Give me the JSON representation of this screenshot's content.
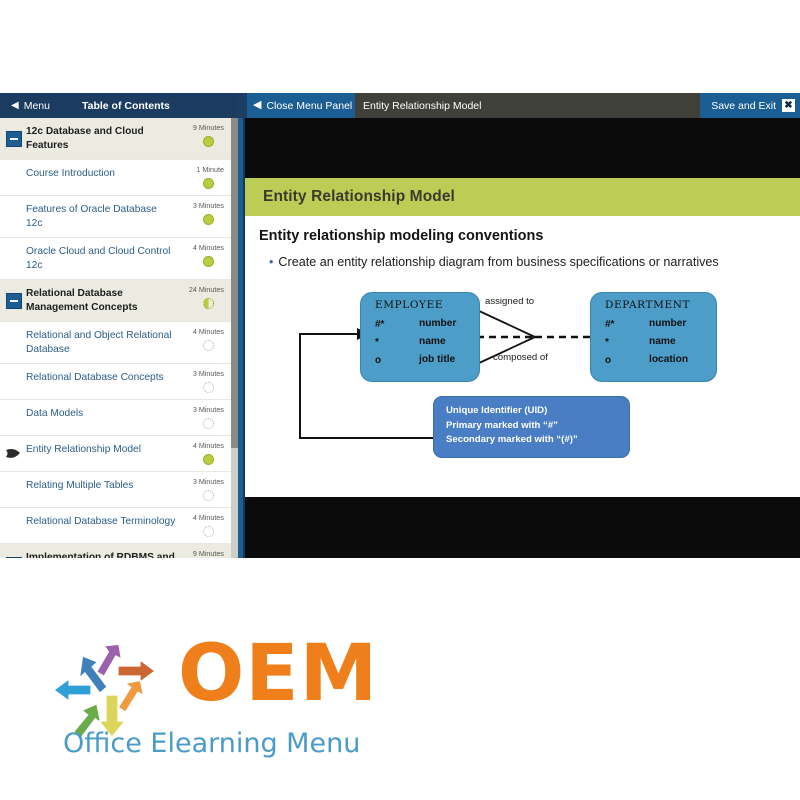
{
  "header": {
    "menu_label": "Menu",
    "menu_chevron": "chevron-left-icon",
    "toc_label": "Table of Contents",
    "close_panel_label": "Close Menu Panel",
    "close_panel_chevron": "chevron-left-icon",
    "lesson_title": "Entity Relationship Model",
    "save_exit_label": "Save and Exit",
    "close_x_label": "✖",
    "colors": {
      "navy": "#1b3c60",
      "blue": "#1b5e94",
      "title_bar": "#40403a"
    }
  },
  "sidebar": {
    "scroll_position": "top",
    "items": [
      {
        "label": "12c Database and Cloud Features",
        "minutes": "9 Minutes",
        "type": "group",
        "status": "done",
        "expander": "collapse-icon",
        "current": false
      },
      {
        "label": "Course Introduction",
        "minutes": "1 Minute",
        "type": "topic",
        "status": "done",
        "current": false
      },
      {
        "label": "Features of Oracle Database 12c",
        "minutes": "3 Minutes",
        "type": "topic",
        "status": "done",
        "current": false
      },
      {
        "label": "Oracle Cloud and Cloud Control 12c",
        "minutes": "4 Minutes",
        "type": "topic",
        "status": "done",
        "current": false
      },
      {
        "label": "Relational Database Management Concepts",
        "minutes": "24 Minutes",
        "type": "group",
        "status": "partial",
        "expander": "collapse-icon",
        "current": false
      },
      {
        "label": "Relational and Object Relational Database",
        "minutes": "4 Minutes",
        "type": "topic",
        "status": "none",
        "current": false
      },
      {
        "label": "Relational Database Concepts",
        "minutes": "3 Minutes",
        "type": "topic",
        "status": "none",
        "current": false
      },
      {
        "label": "Data Models",
        "minutes": "3 Minutes",
        "type": "topic",
        "status": "none",
        "current": false
      },
      {
        "label": "Entity Relationship Model",
        "minutes": "4 Minutes",
        "type": "topic",
        "status": "done",
        "current": true
      },
      {
        "label": "Relating Multiple Tables",
        "minutes": "3 Minutes",
        "type": "topic",
        "status": "none",
        "current": false
      },
      {
        "label": "Relational Database Terminology",
        "minutes": "4 Minutes",
        "type": "topic",
        "status": "none",
        "current": false
      },
      {
        "label": "Implementation of RDBMS and ORDMS",
        "minutes": "9 Minutes",
        "type": "group",
        "status": "none",
        "expander": "collapse-icon",
        "current": false
      }
    ]
  },
  "slide": {
    "title": "Entity Relationship Model",
    "subtitle": "Entity relationship modeling conventions",
    "bullet": "Create an entity relationship diagram from business specifications or narratives",
    "title_bar_color": "#bccc54",
    "diagram": {
      "entities": [
        {
          "name": "EMPLOYEE",
          "attributes": [
            {
              "mark": "#*",
              "name": "number"
            },
            {
              "mark": "*",
              "name": "name"
            },
            {
              "mark": "o",
              "name": "job title"
            }
          ]
        },
        {
          "name": "DEPARTMENT",
          "attributes": [
            {
              "mark": "#*",
              "name": "number"
            },
            {
              "mark": "*",
              "name": "name"
            },
            {
              "mark": "o",
              "name": "location"
            }
          ]
        }
      ],
      "relationships": [
        {
          "label": "assigned to"
        },
        {
          "label": "composed of"
        }
      ],
      "callout": {
        "lines": [
          "Unique Identifier (UID)",
          "Primary marked with “#”",
          "Secondary marked with “(#)”"
        ]
      },
      "entity_fill": "#4c9dc8",
      "callout_fill": "#4a7ec4"
    }
  },
  "logo": {
    "wordmark": "OEM",
    "tagline": "Office Elearning Menu",
    "wordmark_color": "#ef7f1a",
    "tagline_color": "#4a9cc8",
    "arrow_colors": [
      "#3f7fba",
      "#9b62ab",
      "#cc6633",
      "#2f9fd6",
      "#ef9a3d",
      "#6aab4a",
      "#ddd45a"
    ]
  }
}
